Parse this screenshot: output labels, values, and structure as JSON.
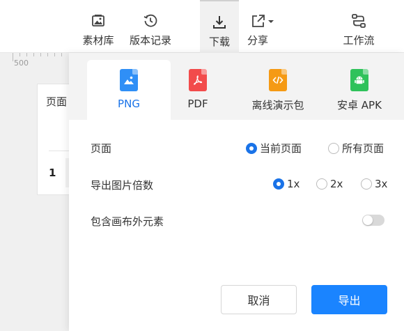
{
  "toolbar": {
    "items": [
      {
        "label": "素材库",
        "icon": "image-library-icon"
      },
      {
        "label": "版本记录",
        "icon": "history-icon"
      },
      {
        "label": "下载",
        "icon": "download-icon"
      },
      {
        "label": "分享",
        "icon": "share-icon"
      },
      {
        "label": "工作流",
        "icon": "workflow-icon"
      }
    ]
  },
  "canvas": {
    "ruler_value": "500",
    "card_header": "页面",
    "card_row_number": "1"
  },
  "export_panel": {
    "tabs": [
      {
        "label": "PNG",
        "icon": "png-file-icon",
        "color": "#2f8ff6"
      },
      {
        "label": "PDF",
        "icon": "pdf-file-icon",
        "color": "#f24b4b"
      },
      {
        "label": "离线演示包",
        "icon": "code-file-icon",
        "color": "#f59a14"
      },
      {
        "label": "安卓 APK",
        "icon": "android-file-icon",
        "color": "#2fc25b"
      }
    ],
    "page_row": {
      "label": "页面",
      "options": [
        "当前页面",
        "所有页面"
      ],
      "selected": "当前页面"
    },
    "scale_row": {
      "label": "导出图片倍数",
      "options": [
        "1x",
        "2x",
        "3x"
      ],
      "selected": "1x"
    },
    "outside_row": {
      "label": "包含画布外元素",
      "toggle_on": false
    },
    "cancel_label": "取消",
    "export_label": "导出"
  },
  "colors": {
    "accent": "#1a73e8",
    "export_button": "#1a84ff"
  }
}
